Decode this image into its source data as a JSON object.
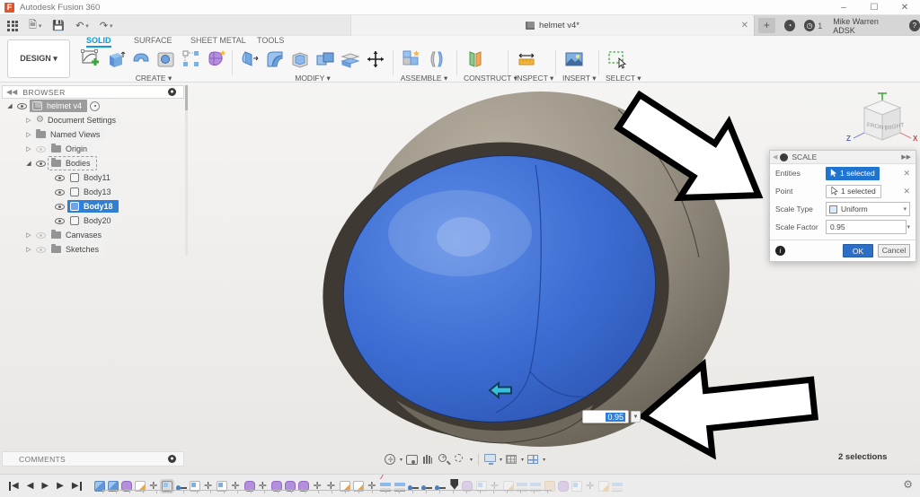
{
  "titlebar": {
    "app_title": "Autodesk Fusion 360",
    "minimize": "–",
    "maximize": "☐",
    "close": "✕"
  },
  "tabstrip": {
    "doc_tab": "helmet v4*",
    "close": "✕",
    "new_tab": "+",
    "notification_count": "1",
    "user": "Mike Warren ADSK",
    "help": "?",
    "quick_access_icons": [
      "app-grid",
      "file-menu",
      "save",
      "undo",
      "redo"
    ]
  },
  "ribbon": {
    "design_label": "DESIGN ▾",
    "tabs": [
      {
        "label": "SOLID",
        "active": true
      },
      {
        "label": "SURFACE",
        "active": false
      },
      {
        "label": "SHEET METAL",
        "active": false
      },
      {
        "label": "TOOLS",
        "active": false
      }
    ],
    "groups": [
      {
        "label": "CREATE ▾",
        "icons": [
          "create-sketch",
          "extrude",
          "sweep",
          "hole",
          "pattern",
          "create-form"
        ]
      },
      {
        "label": "MODIFY ▾",
        "icons": [
          "press-pull",
          "fillet",
          "shell",
          "combine",
          "split-body",
          "move"
        ]
      },
      {
        "label": "ASSEMBLE ▾",
        "icons": [
          "new-component",
          "joint"
        ]
      },
      {
        "label": "CONSTRUCT ▾",
        "icons": [
          "construct-plane"
        ]
      },
      {
        "label": "INSPECT ▾",
        "icons": [
          "measure"
        ]
      },
      {
        "label": "INSERT ▾",
        "icons": [
          "insert-image"
        ]
      },
      {
        "label": "SELECT ▾",
        "icons": [
          "select-window"
        ]
      }
    ]
  },
  "browser": {
    "title": "BROWSER",
    "items": [
      {
        "label": "helmet v4",
        "icon": "component",
        "level": 0,
        "expander": "open",
        "eye": "on",
        "chip": "dark",
        "extra": "activate"
      },
      {
        "label": "Document Settings",
        "icon": "gear",
        "level": 1,
        "expander": "closed"
      },
      {
        "label": "Named Views",
        "icon": "folder",
        "level": 1,
        "expander": "closed"
      },
      {
        "label": "Origin",
        "icon": "folder",
        "level": 1,
        "expander": "closed",
        "eye": "off"
      },
      {
        "label": "Bodies",
        "icon": "folder",
        "level": 1,
        "expander": "open",
        "eye": "on",
        "dashed": true
      },
      {
        "label": "Body11",
        "icon": "body",
        "level": 2,
        "eye": "on"
      },
      {
        "label": "Body13",
        "icon": "body",
        "level": 2,
        "eye": "on"
      },
      {
        "label": "Body18",
        "icon": "body",
        "level": 2,
        "eye": "on",
        "chip": "blue"
      },
      {
        "label": "Body20",
        "icon": "body",
        "level": 2,
        "eye": "on"
      },
      {
        "label": "Canvases",
        "icon": "folder",
        "level": 1,
        "expander": "closed",
        "eye": "off"
      },
      {
        "label": "Sketches",
        "icon": "folder",
        "level": 1,
        "expander": "closed",
        "eye": "off"
      }
    ]
  },
  "viewcube": {
    "front": "FRONT",
    "right": "RIGHT",
    "axis_x": "X",
    "axis_z": "Z"
  },
  "scale_dialog": {
    "title": "SCALE",
    "rows": [
      {
        "label": "Entities",
        "value": "1 selected"
      },
      {
        "label": "Point",
        "value": "1 selected"
      },
      {
        "label": "Scale Type",
        "value": "Uniform"
      },
      {
        "label": "Scale Factor",
        "value": "0.95"
      }
    ],
    "ok_label": "OK",
    "cancel_label": "Cancel",
    "close": "✕"
  },
  "canvas_input": {
    "value": "0.95"
  },
  "comments": {
    "label": "COMMENTS"
  },
  "navbar": {
    "icons": [
      "orbit",
      "look-at",
      "pan",
      "zoom",
      "zoom-window",
      "display-settings",
      "grid-settings",
      "viewports"
    ]
  },
  "status": {
    "selections": "2 selections"
  },
  "timeline": {
    "playback": [
      "skip-start",
      "step-back",
      "play",
      "step-forward",
      "skip-end"
    ],
    "icons": [
      "img",
      "img",
      "form",
      "sketch",
      "move",
      "boxsel",
      "offset",
      "box",
      "move",
      "box",
      "move",
      "form",
      "move",
      "form",
      "form",
      "form",
      "move",
      "move",
      "sketch",
      "sketch",
      "move",
      "stack-marked",
      "stack",
      "offset",
      "offset",
      "offset",
      "marker",
      "form",
      "box",
      "move",
      "sketch",
      "stack",
      "stack",
      "shell",
      "form",
      "box",
      "move",
      "sketch",
      "stack"
    ]
  },
  "colors": {
    "accent_blue": "#0a9bd8",
    "selection_blue": "#2f7fd4",
    "ok_blue": "#2d6fc4",
    "visor_blue": "#3a6ad0",
    "helmet_gray": "#8d867a",
    "form_purple": "#b490dc"
  }
}
